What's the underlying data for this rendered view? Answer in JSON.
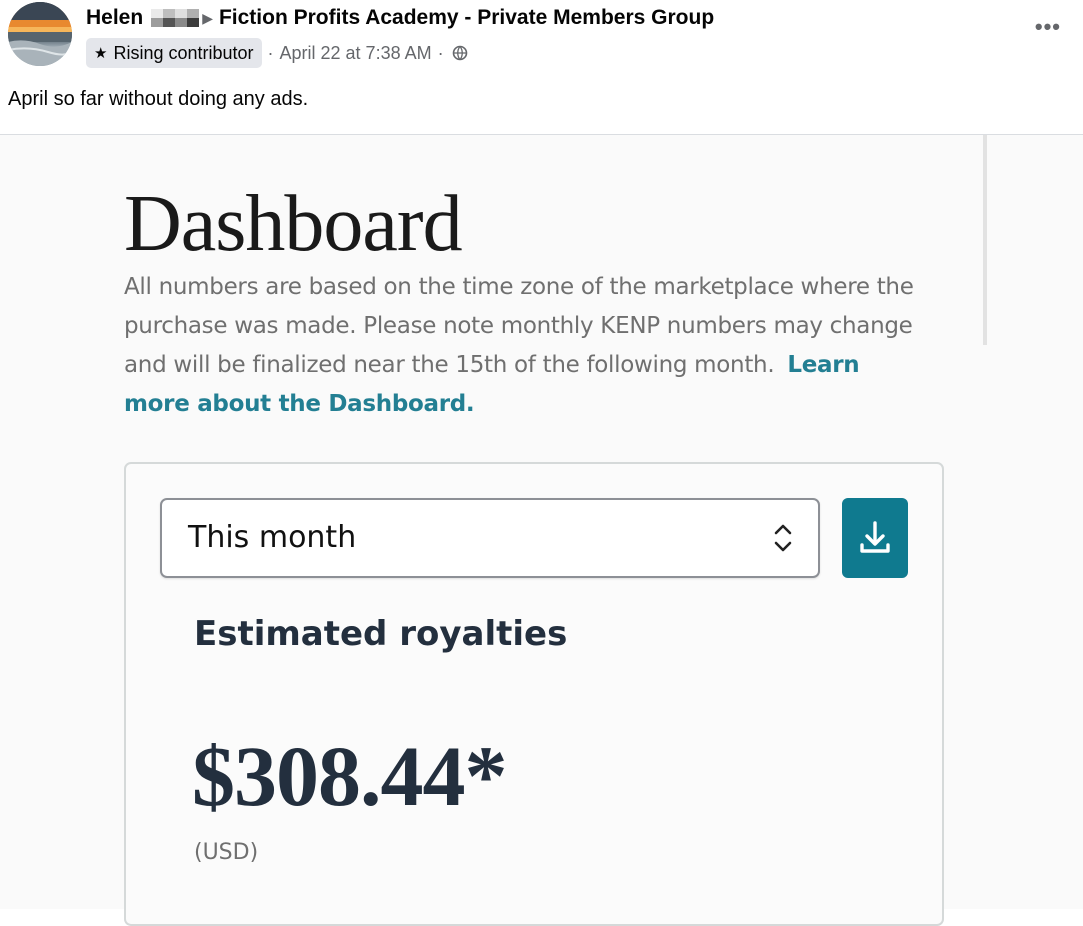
{
  "post": {
    "author": "Helen",
    "group": "Fiction Profits Academy - Private Members Group",
    "badge": "Rising contributor",
    "timestamp": "April 22 at 7:38 AM",
    "meta_separator": "·",
    "more_icon": "more-dots-icon",
    "text": "April so far without doing any ads."
  },
  "dashboard": {
    "title": "Dashboard",
    "description": "All numbers are based on the time zone of the marketplace where the purchase was made. Please note monthly KENP numbers may change and will be finalized near the 15th of the following month.",
    "link": "Learn more about the Dashboard.",
    "period_select": "This month",
    "royalties_label": "Estimated royalties",
    "royalties_value": "$308.44*",
    "currency": "(USD)"
  },
  "colors": {
    "accent": "#0f7a8f",
    "link": "#237f93",
    "heading": "#232f3e"
  }
}
